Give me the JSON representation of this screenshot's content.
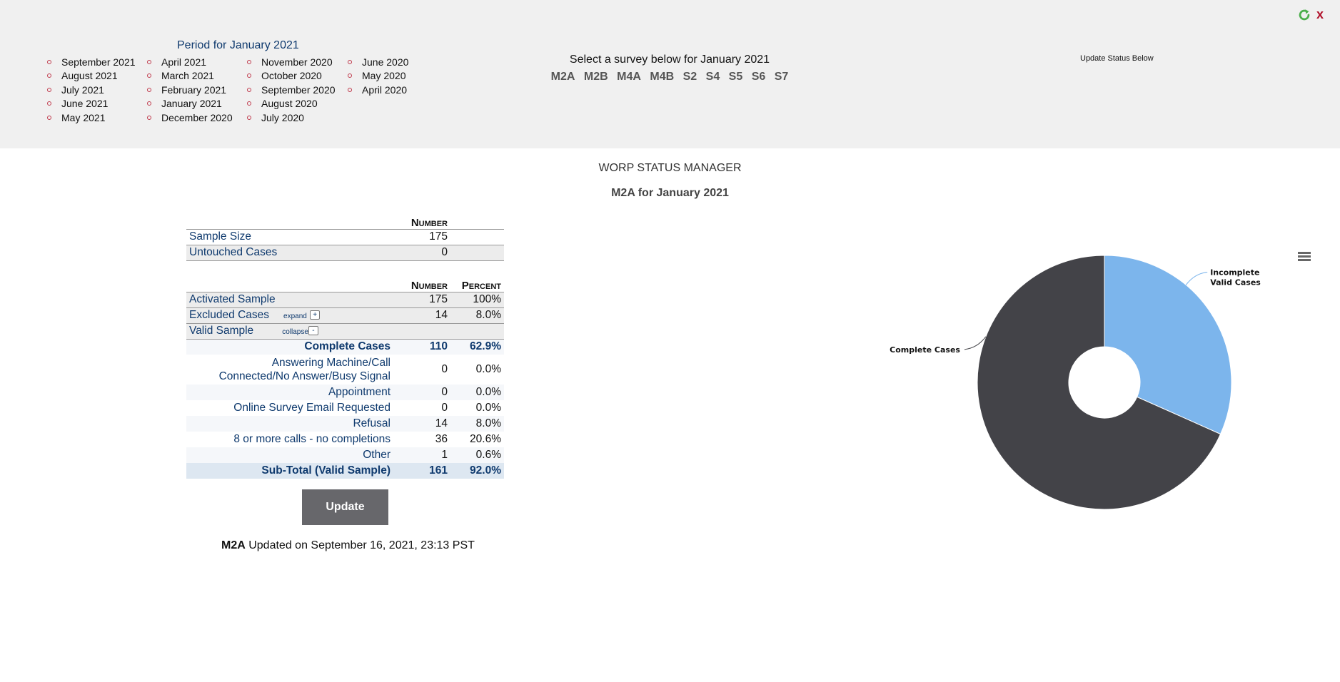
{
  "header": {
    "period_title": "Period for January 2021",
    "period_columns": [
      [
        "September 2021",
        "August 2021",
        "July 2021",
        "June 2021",
        "May 2021"
      ],
      [
        "April 2021",
        "March 2021",
        "February 2021",
        "January 2021",
        "December 2020"
      ],
      [
        "November 2020",
        "October 2020",
        "September 2020",
        "August 2020",
        "July 2020"
      ],
      [
        "June 2020",
        "May 2020",
        "April 2020"
      ]
    ],
    "survey_prompt": "Select a survey below for January 2021",
    "surveys": [
      "M2A",
      "M2B",
      "M4A",
      "M4B",
      "S2",
      "S4",
      "S5",
      "S6",
      "S7"
    ],
    "update_status": "Update Status Below",
    "refresh_icon": "refresh-icon",
    "close_label": "x"
  },
  "main": {
    "title": "WORP STATUS MANAGER",
    "subtitle": "M2A for January 2021"
  },
  "table1": {
    "header_number": "Number",
    "rows": [
      {
        "label": "Sample Size",
        "number": "175"
      },
      {
        "label": "Untouched Cases",
        "number": "0"
      }
    ]
  },
  "table2": {
    "header_number": "Number",
    "header_percent": "Percent",
    "activated": {
      "label": "Activated Sample",
      "number": "175",
      "percent": "100%"
    },
    "excluded": {
      "label": "Excluded Cases",
      "control": "expand",
      "button": "+",
      "number": "14",
      "percent": "8.0%"
    },
    "valid": {
      "label": "Valid Sample",
      "control": "collapse",
      "button": "-"
    },
    "sub_rows": [
      {
        "label": "Complete Cases",
        "number": "110",
        "percent": "62.9%"
      },
      {
        "label_line1": "Answering Machine/Call",
        "label_line2": "Connected/No Answer/Busy Signal",
        "number": "0",
        "percent": "0.0%"
      },
      {
        "label": "Appointment",
        "number": "0",
        "percent": "0.0%"
      },
      {
        "label": "Online Survey Email Requested",
        "number": "0",
        "percent": "0.0%"
      },
      {
        "label": "Refusal",
        "number": "14",
        "percent": "8.0%"
      },
      {
        "label": "8 or more calls - no completions",
        "number": "36",
        "percent": "20.6%"
      },
      {
        "label": "Other",
        "number": "1",
        "percent": "0.6%"
      }
    ],
    "subtotal": {
      "label": "Sub-Total (Valid Sample)",
      "number": "161",
      "percent": "92.0%"
    }
  },
  "update_button": "Update",
  "updated": {
    "survey": "M2A",
    "text": " Updated on September 16, 2021, 23:13 PST"
  },
  "chart_menu_icon": "hamburger-menu-icon",
  "chart_data": {
    "type": "pie",
    "donut": true,
    "title": "",
    "series": [
      {
        "name": "Incomplete Valid Cases",
        "label_lines": [
          "Incomplete",
          "Valid Cases"
        ],
        "value": 51,
        "color": "#7cb5ec"
      },
      {
        "name": "Complete Cases",
        "label_lines": [
          "Complete Cases"
        ],
        "value": 110,
        "color": "#434348"
      }
    ]
  }
}
